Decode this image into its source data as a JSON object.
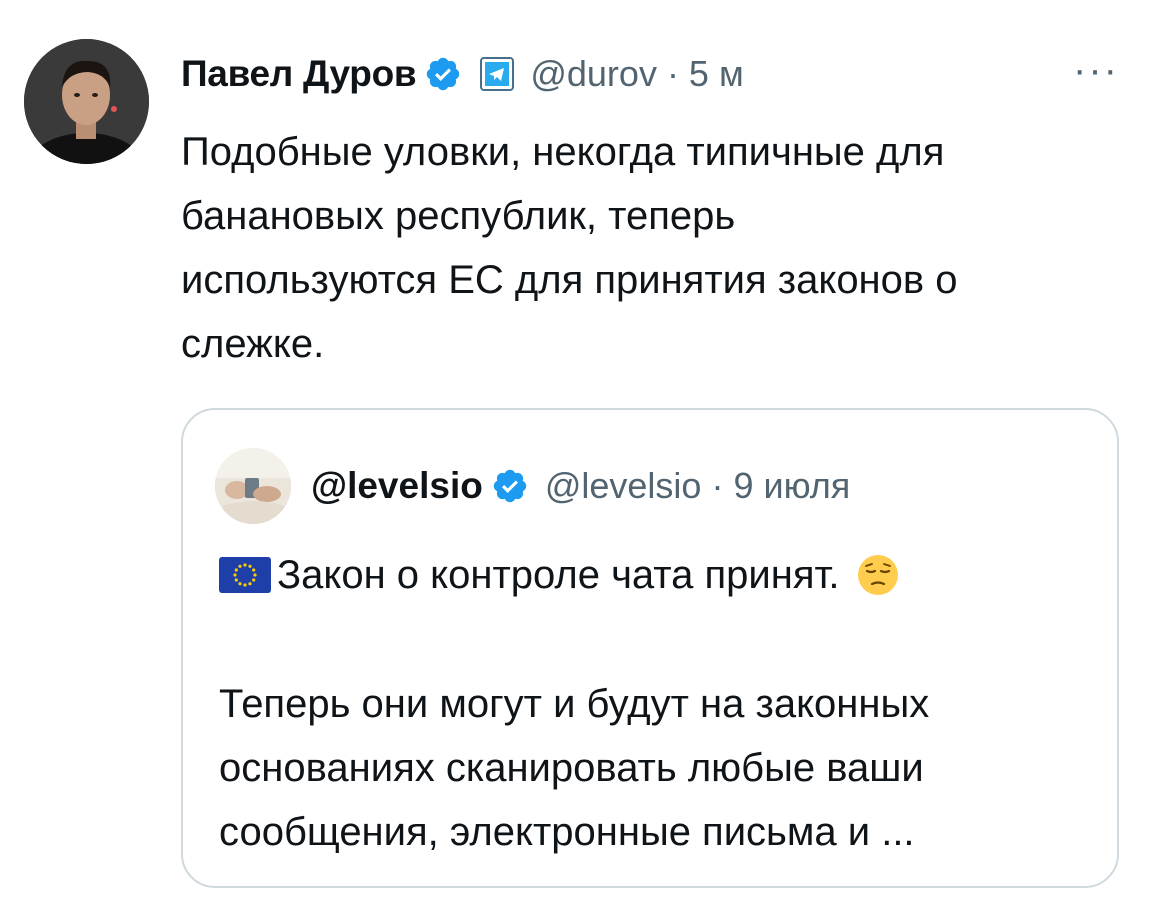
{
  "tweet": {
    "author": {
      "display_name": "Павел Дуров",
      "handle_line": "@durov · 5 м",
      "avatar_icon": "person-avatar-icon",
      "verified_icon": "verified-badge-icon",
      "affiliation_icon": "telegram-logo-icon"
    },
    "more_label": "···",
    "text": "Подобные уловки, некогда типичные для\nбанановых республик, теперь\nиспользуются ЕС для принятия законов о\nслежке."
  },
  "quoted_tweet": {
    "author": {
      "display_name": "@levelsio",
      "handle_line": "@levelsio · 9 июля",
      "avatar_icon": "person-avatar-icon",
      "verified_icon": "verified-badge-icon"
    },
    "first_line": "Закон о контроле чата принят.",
    "flag_icon": "eu-flag-icon",
    "emoji_icon": "pensive-face-emoji",
    "text": "Теперь они могут и будут на законных\nоснованиях сканировать любые ваши\nсообщения, электронные письма и ..."
  },
  "colors": {
    "text_primary": "#0f1419",
    "text_secondary": "#536471",
    "verified_blue": "#1d9bf0",
    "border": "#cfd9de",
    "telegram_blue": "#2aabee",
    "eu_blue": "#1f3fa8",
    "eu_gold": "#ffcc00"
  }
}
